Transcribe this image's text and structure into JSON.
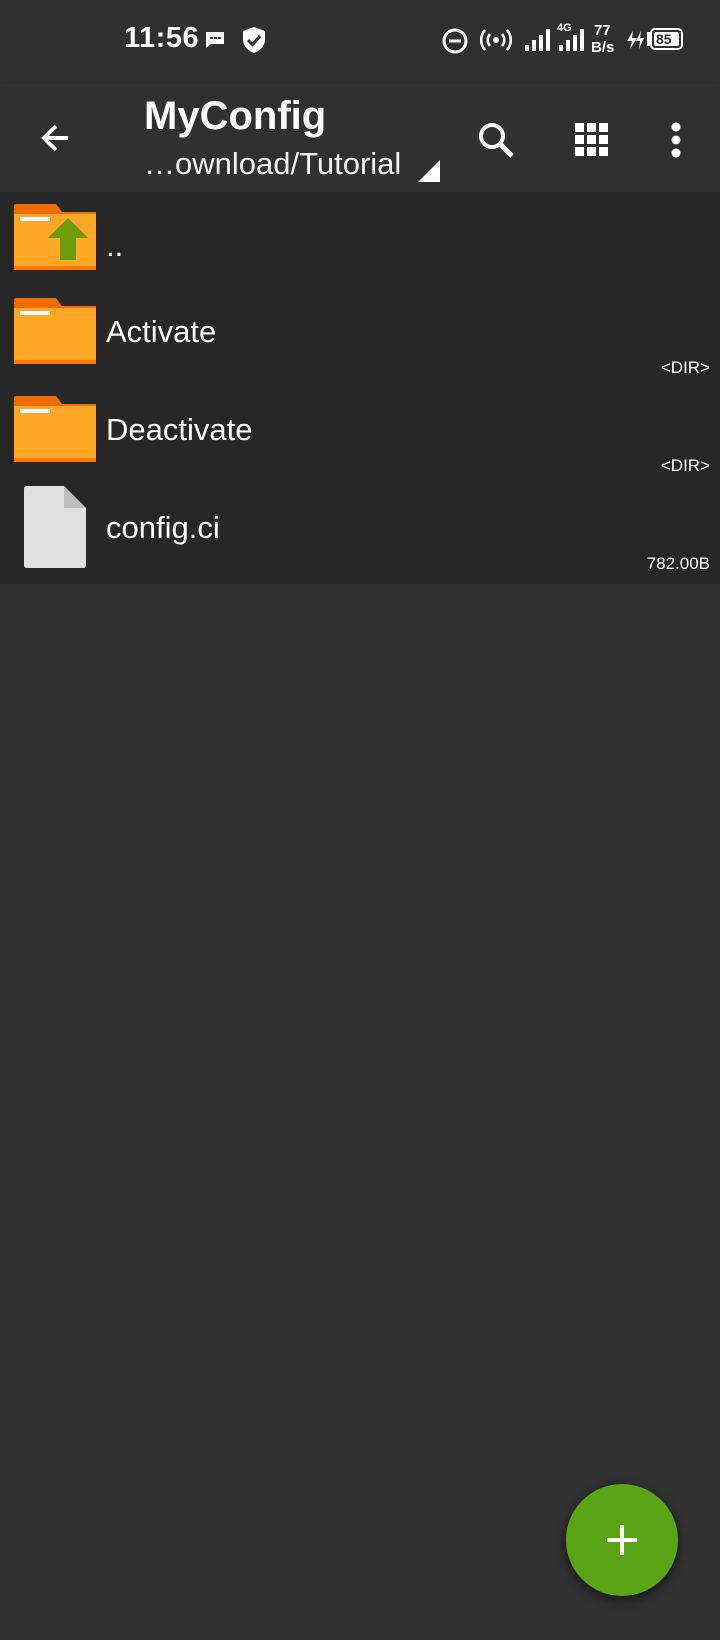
{
  "status_bar": {
    "time": "11:56",
    "network_type": "4G",
    "speed_value": "77",
    "speed_unit": "B/s",
    "battery": "85",
    "icons": [
      "message-icon",
      "shield-check-icon",
      "do-not-disturb-icon",
      "hotspot-icon",
      "signal-icon",
      "signal-4g-icon",
      "charging-icon",
      "battery-icon"
    ]
  },
  "app_bar": {
    "title": "MyConfig",
    "path": "…ownload/Tutorial",
    "icons": [
      "back-arrow-icon",
      "search-icon",
      "grid-view-icon",
      "more-vert-icon"
    ]
  },
  "files": [
    {
      "name": "..",
      "meta": "",
      "type": "parent"
    },
    {
      "name": "Activate",
      "meta": "<DIR>",
      "type": "folder"
    },
    {
      "name": "Deactivate",
      "meta": "<DIR>",
      "type": "folder"
    },
    {
      "name": "config.ci",
      "meta": "782.00B",
      "type": "file"
    }
  ],
  "fab": {
    "icon": "add-icon"
  },
  "colors": {
    "background": "#303030",
    "list_background": "#272727",
    "folder": "#FFA726",
    "folder_tab": "#EF6C00",
    "up_arrow": "#6B9B0A",
    "fab": "#5AA516",
    "file_icon": "#E0E0E0"
  }
}
